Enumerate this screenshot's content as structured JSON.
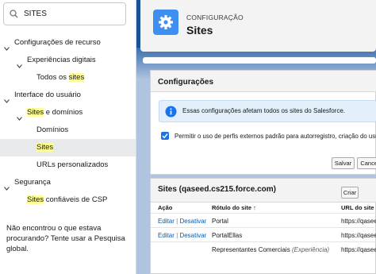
{
  "sidebar": {
    "search_value": "SITES",
    "tree": [
      {
        "label": "Configurações de recurso",
        "level": 0,
        "expanded": true
      },
      {
        "label": "Experiências digitais",
        "level": 1,
        "expanded": true
      },
      {
        "label_pre": "Todos os ",
        "label_hl": "sites",
        "level": 2
      },
      {
        "label": "Interface do usuário",
        "level": 0,
        "expanded": true
      },
      {
        "label_hl": "Sites",
        "label_post": " e domínios",
        "level": 1,
        "expanded": true
      },
      {
        "label": "Domínios",
        "level": 2
      },
      {
        "label_hl": "Sites",
        "level": 2,
        "selected": true
      },
      {
        "label": "URLs personalizados",
        "level": 2
      },
      {
        "label": "Segurança",
        "level": 0,
        "expanded": true
      },
      {
        "label_hl": "Sites",
        "label_post": " confiáveis de CSP",
        "level": 1
      }
    ],
    "not_found_note": "Não encontrou o que estava procurando? Tente usar a Pesquisa global."
  },
  "header": {
    "eyebrow": "CONFIGURAÇÃO",
    "title": "Sites",
    "icon": "gear-icon"
  },
  "config_panel": {
    "title": "Configurações",
    "info_text": "Essas configurações afetam todos os sites do Salesforce.",
    "checkbox_label": "Permitir o uso de perfis externos padrão para autorregistro, criação do usu",
    "checkbox_checked": true,
    "save_label": "Salvar",
    "cancel_label": "Cancel"
  },
  "sites_panel": {
    "title": "Sites (qaseed.cs215.force.com)",
    "new_label": "Criar",
    "columns": [
      "Ação",
      "Rótulo do site ↑",
      "URL do site"
    ],
    "rows": [
      {
        "edit": "Editar",
        "sep": " | ",
        "deactivate": "Desativar",
        "label": "Portal",
        "label_note": "",
        "url": "https://qasee"
      },
      {
        "edit": "Editar",
        "sep": " | ",
        "deactivate": "Desativar",
        "label": "PortalEllas",
        "label_note": "",
        "url": "https://qasee"
      },
      {
        "edit": "",
        "sep": "",
        "deactivate": "",
        "label": "Representantes Comerciais",
        "label_note": "(Experiência)",
        "url": "https://qasee"
      }
    ]
  },
  "colors": {
    "accent_blue": "#1b5297",
    "link": "#0b5cab",
    "highlight": "#fdfd9b",
    "app_icon_bg": "#3e8ff0"
  }
}
